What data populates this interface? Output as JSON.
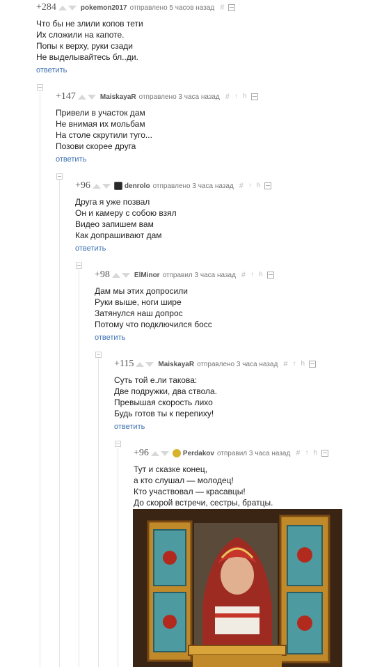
{
  "comments": [
    {
      "rating": "+284",
      "author": "pokemon2017",
      "meta": "отправлено 5 часов назад",
      "lines": [
        "Что бы не злили копов тети",
        "Их сложили на капоте.",
        "Попы к верху, руки сзади",
        "Не выделывайтесь бл..ди."
      ],
      "reply": "ответить"
    },
    {
      "rating": "+147",
      "author": "MaiskayaR",
      "meta": "отправлено 3 часа назад",
      "lines": [
        "Привели в участок дам",
        "Не внимая их мольбам",
        "На столе скрутили туго...",
        "Позови скорее друга"
      ],
      "reply": "ответить"
    },
    {
      "rating": "+96",
      "author": "denrolo",
      "meta": "отправлено 3 часа назад",
      "lines": [
        "Друга я уже позвал",
        "Он и камеру с собою взял",
        "Видео запишем вам",
        "Как допрашивают дам"
      ],
      "reply": "ответить"
    },
    {
      "rating": "+98",
      "author": "ElMinor",
      "meta": "отправил 3 часа назад",
      "lines": [
        "Дам мы этих допросили",
        "Руки выше, ноги шире",
        "Затянулся наш допрос",
        "Потому что подключился босс"
      ],
      "reply": "ответить"
    },
    {
      "rating": "+115",
      "author": "MaiskayaR",
      "meta": "отправлено 3 часа назад",
      "lines": [
        "Суть той е.ли такова:",
        "Две подружки, два ствола.",
        "Превышая скорость лихо",
        "Будь готов ты к перепиху!"
      ],
      "reply": "ответить"
    },
    {
      "rating": "+96",
      "author": "Perdakov",
      "meta": "отправил 3 часа назад",
      "lines": [
        "Тут и сказке конец,",
        "а кто слушал — молодец!",
        "Кто участвовал — красавцы!",
        "До скорой встречи, сестры, братцы."
      ]
    }
  ],
  "icons": {
    "hash": "#",
    "save": "save-icon",
    "link": "link-icon",
    "tree": "tree-icon"
  },
  "colors": {
    "reply_link": "#3b6fb0",
    "vote_arrow": "#d8d8d8",
    "text": "#222222"
  }
}
